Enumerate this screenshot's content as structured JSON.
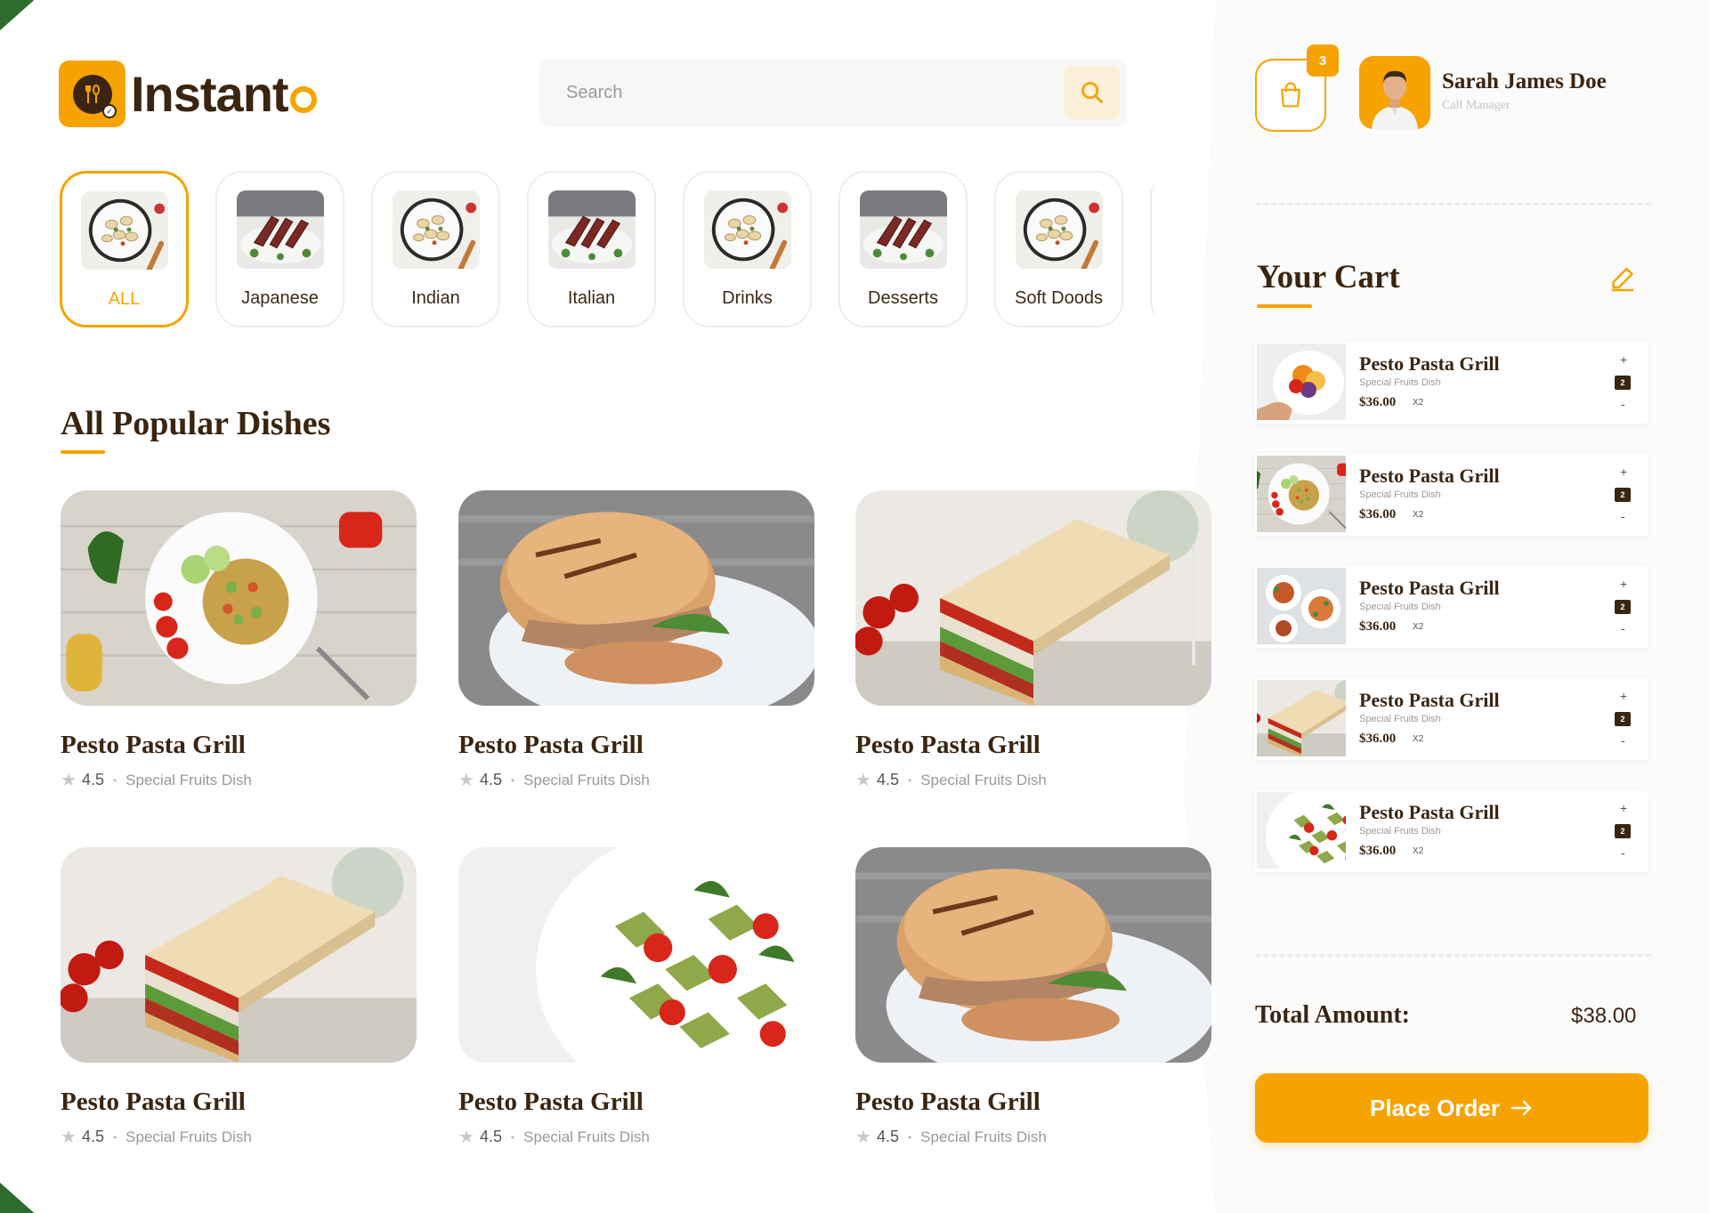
{
  "app": {
    "name": "Instant",
    "name_suffix": "o"
  },
  "search": {
    "placeholder": "Search"
  },
  "categories": [
    {
      "label": "ALL",
      "active": true,
      "thumb": "pasta-plate"
    },
    {
      "label": "Japanese",
      "active": false,
      "thumb": "steak"
    },
    {
      "label": "Indian",
      "active": false,
      "thumb": "pasta-plate"
    },
    {
      "label": "Italian",
      "active": false,
      "thumb": "steak"
    },
    {
      "label": "Drinks",
      "active": false,
      "thumb": "pasta-plate"
    },
    {
      "label": "Desserts",
      "active": false,
      "thumb": "steak"
    },
    {
      "label": "Soft Doods",
      "active": false,
      "thumb": "pasta-plate"
    }
  ],
  "popular": {
    "title": "All Popular Dishes",
    "dishes": [
      {
        "name": "Pesto Pasta Grill",
        "rating": "4.5",
        "subtitle": "Special Fruits Dish",
        "image": "rice-plate"
      },
      {
        "name": "Pesto Pasta Grill",
        "rating": "4.5",
        "subtitle": "Special Fruits Dish",
        "image": "bagel"
      },
      {
        "name": "Pesto Pasta Grill",
        "rating": "4.5",
        "subtitle": "Special Fruits Dish",
        "image": "club-sandwich"
      },
      {
        "name": "Pesto Pasta Grill",
        "rating": "4.5",
        "subtitle": "Special Fruits Dish",
        "image": "club-sandwich"
      },
      {
        "name": "Pesto Pasta Grill",
        "rating": "4.5",
        "subtitle": "Special Fruits Dish",
        "image": "pasta-salad"
      },
      {
        "name": "Pesto Pasta Grill",
        "rating": "4.5",
        "subtitle": "Special Fruits Dish",
        "image": "bagel"
      }
    ]
  },
  "header": {
    "cart_count": "3",
    "user_name": "Sarah James Doe",
    "user_role": "Call Manager"
  },
  "cart": {
    "title": "Your Cart",
    "items": [
      {
        "name": "Pesto Pasta Grill",
        "subtitle": "Special Fruits Dish",
        "price": "$36.00",
        "qty_label": "X2",
        "count": "2",
        "image": "fruit-bowl"
      },
      {
        "name": "Pesto Pasta Grill",
        "subtitle": "Special Fruits Dish",
        "price": "$36.00",
        "qty_label": "X2",
        "count": "2",
        "image": "rice-plate"
      },
      {
        "name": "Pesto Pasta Grill",
        "subtitle": "Special Fruits Dish",
        "price": "$36.00",
        "qty_label": "X2",
        "count": "2",
        "image": "platter"
      },
      {
        "name": "Pesto Pasta Grill",
        "subtitle": "Special Fruits Dish",
        "price": "$36.00",
        "qty_label": "X2",
        "count": "2",
        "image": "club-sandwich"
      },
      {
        "name": "Pesto Pasta Grill",
        "subtitle": "Special Fruits Dish",
        "price": "$36.00",
        "qty_label": "X2",
        "count": "2",
        "image": "pasta-salad"
      }
    ],
    "plus_symbol": "+",
    "minus_symbol": "-",
    "total_label": "Total Amount:",
    "total_value": "$38.00",
    "place_order_label": "Place Order"
  },
  "colors": {
    "accent": "#f6a300",
    "brown": "#3b2510",
    "bg": "#ffffff",
    "panel": "#fbfbfa"
  }
}
